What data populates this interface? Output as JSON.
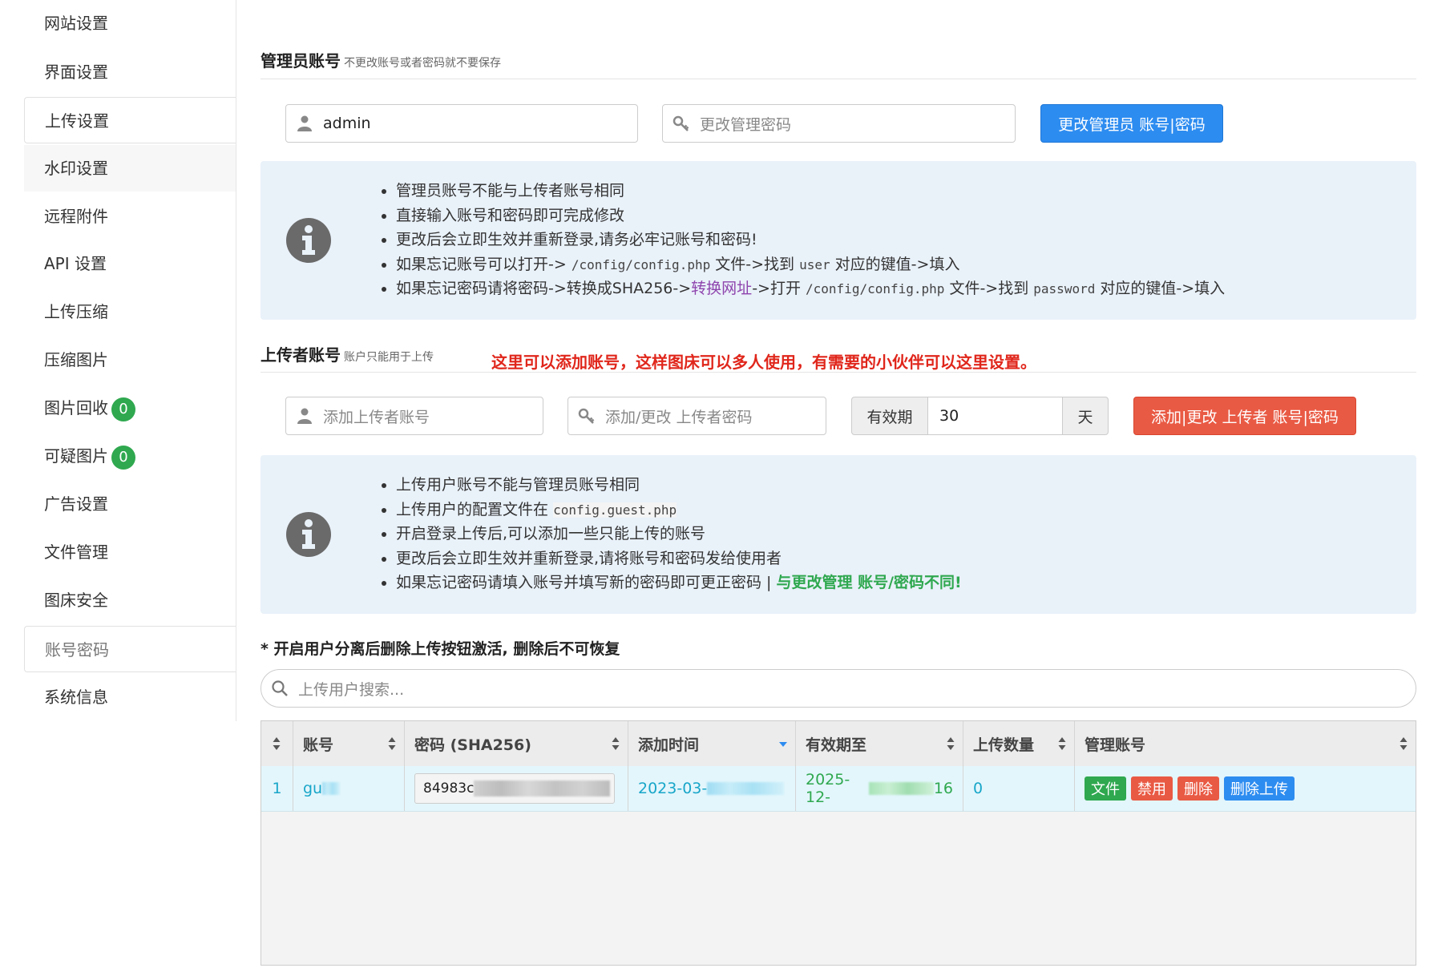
{
  "sidebar": {
    "items": [
      {
        "label": "网站设置"
      },
      {
        "label": "界面设置"
      },
      {
        "label": "上传设置"
      },
      {
        "label": "水印设置"
      },
      {
        "label": "远程附件"
      },
      {
        "label": "API 设置"
      },
      {
        "label": "上传压缩"
      },
      {
        "label": "压缩图片"
      },
      {
        "label": "图片回收",
        "badge": "0"
      },
      {
        "label": "可疑图片",
        "badge": "0"
      },
      {
        "label": "广告设置"
      },
      {
        "label": "文件管理"
      },
      {
        "label": "图床安全"
      },
      {
        "label": "账号密码"
      },
      {
        "label": "系统信息"
      }
    ],
    "active": "账号密码"
  },
  "admin": {
    "title": "管理员账号",
    "subtitle": "不更改账号或者密码就不要保存",
    "username_value": "admin",
    "password_placeholder": "更改管理密码",
    "submit_label": "更改管理员 账号|密码",
    "tips": {
      "t1": "管理员账号不能与上传者账号相同",
      "t2": "直接输入账号和密码即可完成修改",
      "t3": "更改后会立即生效并重新登录,请务必牢记账号和密码!",
      "t4a": "如果忘记账号可以打开->",
      "t4b": "/config/config.php",
      "t4c": "文件->找到",
      "t4d": "user",
      "t4e": "对应的键值->填入",
      "t5a": "如果忘记密码请将密码->转换成SHA256->",
      "t5b": "转换网址",
      "t5c": "->打开",
      "t5d": "/config/config.php",
      "t5e": "文件->找到",
      "t5f": "password",
      "t5g": "对应的键值->填入"
    }
  },
  "uploader": {
    "title": "上传者账号",
    "subtitle": "账户只能用于上传",
    "note": "这里可以添加账号，这样图床可以多人使用，有需要的小伙伴可以这里设置。",
    "username_placeholder": "添加上传者账号",
    "password_placeholder": "添加/更改 上传者密码",
    "validity_label": "有效期",
    "validity_value": "30",
    "validity_unit": "天",
    "submit_label": "添加|更改 上传者 账号|密码",
    "tips": {
      "t1": "上传用户账号不能与管理员账号相同",
      "t2a": "上传用户的配置文件在",
      "t2b": "config.guest.php",
      "t3": "开启登录上传后,可以添加一些只能上传的账号",
      "t4": "更改后会立即生效并重新登录,请将账号和密码发给使用者",
      "t5a": "如果忘记密码请填入账号并填写新的密码即可更正密码 |",
      "t5b": "与更改管理 账号/密码不同!"
    }
  },
  "warning": "* 开启用户分离后删除上传按钮激活, 删除后不可恢复",
  "search": {
    "placeholder": "上传用户搜索..."
  },
  "table": {
    "headers": {
      "account": "账号",
      "password": "密码 (SHA256)",
      "added": "添加时间",
      "expires": "有效期至",
      "uploads": "上传数量",
      "manage": "管理账号"
    },
    "row": {
      "index": "1",
      "account": "gu",
      "hash": "84983c",
      "added": "2023-03-",
      "expires_a": "2025-12-",
      "expires_b": "16",
      "uploads": "0",
      "actions": {
        "files": "文件",
        "disable": "禁用",
        "delete": "删除",
        "delete_uploads": "删除上传"
      }
    }
  },
  "colors": {
    "primary": "#2d8cf0",
    "danger": "#e95a44",
    "success": "#2fa84f",
    "info_bg": "#e9f1f9",
    "row_bg": "#e3f6fc"
  }
}
